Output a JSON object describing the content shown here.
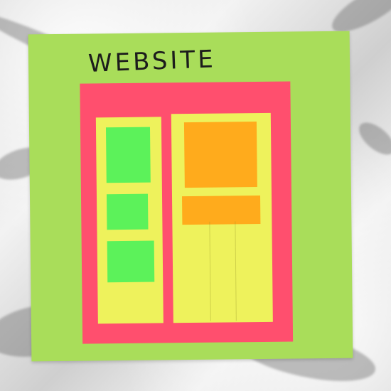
{
  "note": {
    "title": "WEBSITE"
  },
  "colors": {
    "marble": "#e6e6e6",
    "note": "#a9dd5a",
    "frame": "#ff4f6e",
    "column": "#eef25c",
    "green_block": "#5cf25a",
    "orange_block": "#ffab1c"
  }
}
